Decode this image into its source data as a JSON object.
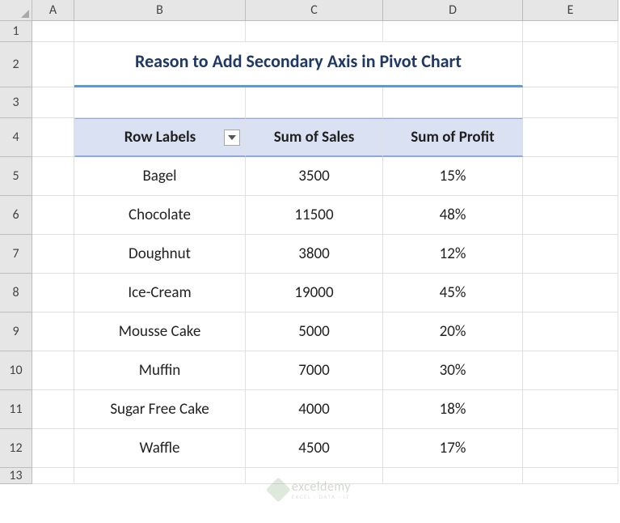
{
  "columns": [
    "A",
    "B",
    "C",
    "D",
    "E"
  ],
  "rows": [
    "1",
    "2",
    "3",
    "4",
    "5",
    "6",
    "7",
    "8",
    "9",
    "10",
    "11",
    "12",
    "13"
  ],
  "title": "Reason to Add Secondary Axis in Pivot Chart",
  "pivot": {
    "headers": {
      "row_labels": "Row Labels",
      "sum_sales": "Sum of Sales",
      "sum_profit": "Sum of Profit"
    },
    "data": [
      {
        "label": "Bagel",
        "sales": "3500",
        "profit": "15%"
      },
      {
        "label": "Chocolate",
        "sales": "11500",
        "profit": "48%"
      },
      {
        "label": "Doughnut",
        "sales": "3800",
        "profit": "12%"
      },
      {
        "label": "Ice-Cream",
        "sales": "19000",
        "profit": "45%"
      },
      {
        "label": "Mousse Cake",
        "sales": "5000",
        "profit": "20%"
      },
      {
        "label": "Muffin",
        "sales": "7000",
        "profit": "30%"
      },
      {
        "label": "Sugar Free Cake",
        "sales": "4000",
        "profit": "18%"
      },
      {
        "label": "Waffle",
        "sales": "4500",
        "profit": "17%"
      }
    ]
  },
  "watermark": {
    "brand": "exceldemy",
    "tagline": "EXCEL · DATA · IT"
  },
  "chart_data": {
    "type": "table",
    "title": "Reason to Add Secondary Axis in Pivot Chart",
    "columns": [
      "Row Labels",
      "Sum of Sales",
      "Sum of Profit"
    ],
    "rows": [
      [
        "Bagel",
        3500,
        "15%"
      ],
      [
        "Chocolate",
        11500,
        "48%"
      ],
      [
        "Doughnut",
        3800,
        "12%"
      ],
      [
        "Ice-Cream",
        19000,
        "45%"
      ],
      [
        "Mousse Cake",
        5000,
        "20%"
      ],
      [
        "Muffin",
        7000,
        "30%"
      ],
      [
        "Sugar Free Cake",
        4000,
        "18%"
      ],
      [
        "Waffle",
        4500,
        "17%"
      ]
    ]
  }
}
